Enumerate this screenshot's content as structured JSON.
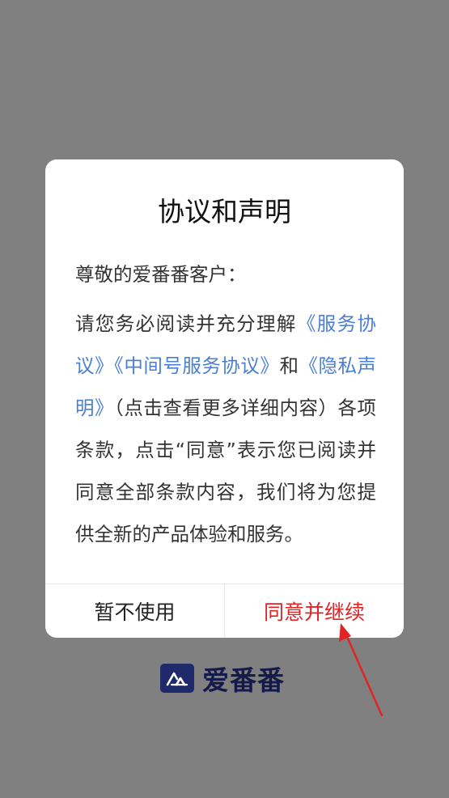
{
  "dialog": {
    "title": "协议和声明",
    "greeting": "尊敬的爱番番客户：",
    "body": {
      "lead": "请您务必阅读并充分理解",
      "link_service": "《服务协议》",
      "link_middle": "《中间号服务协议》",
      "and": "和",
      "link_privacy": "《隐私声明》",
      "note": "（点击查看更多详细内容）各项条款，点击“同意”表示您已阅读并同意全部条款内容，我们将为您提供全新的产品体验和服务。"
    },
    "decline_label": "暂不使用",
    "accept_label": "同意并继续"
  },
  "brand": {
    "name": "爱番番",
    "logo_icon": "mountain-logo-icon",
    "logo_color": "#1f2a6b"
  },
  "annotation": {
    "arrow_color": "#e02424"
  }
}
